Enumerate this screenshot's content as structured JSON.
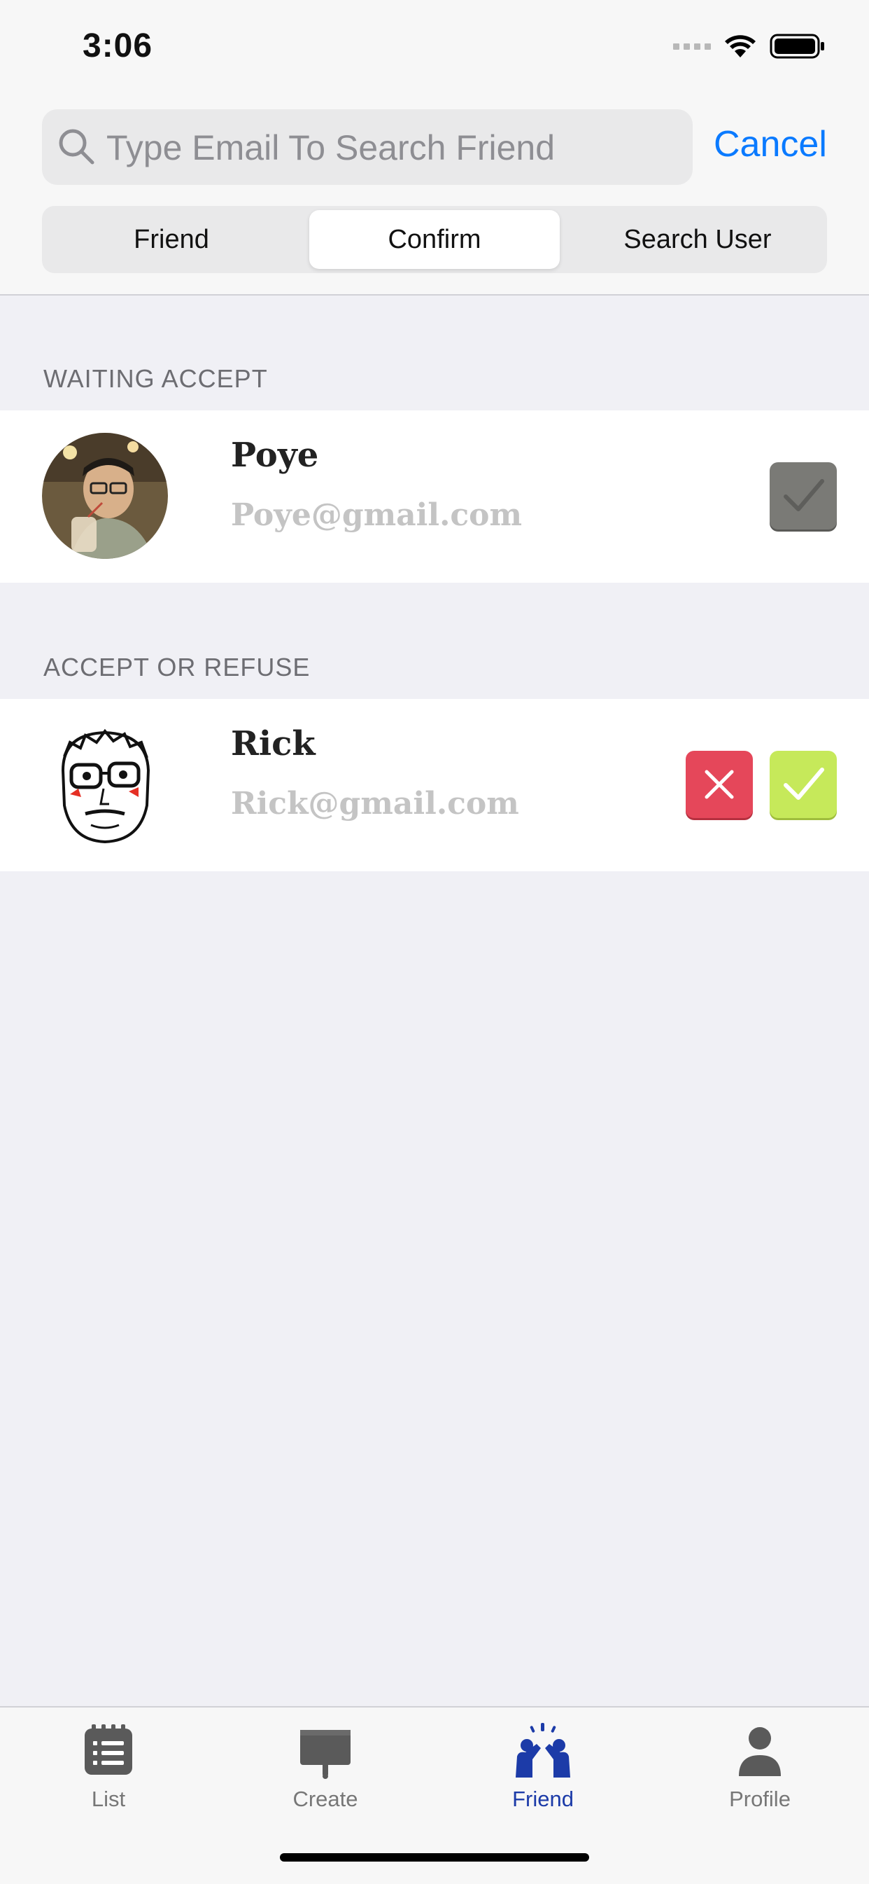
{
  "status_bar": {
    "time": "3:06"
  },
  "search": {
    "placeholder": "Type Email To Search Friend",
    "cancel_label": "Cancel"
  },
  "segments": [
    {
      "label": "Friend",
      "selected": false
    },
    {
      "label": "Confirm",
      "selected": true
    },
    {
      "label": "Search User",
      "selected": false
    }
  ],
  "sections": {
    "waiting": {
      "title": "WAITING ACCEPT",
      "item": {
        "name": "Poye",
        "email": "Poye@gmail.com",
        "status_icon": "check-icon-disabled"
      }
    },
    "accept_refuse": {
      "title": "ACCEPT OR REFUSE",
      "item": {
        "name": "Rick",
        "email": "Rick@gmail.com",
        "refuse_icon": "x-icon",
        "accept_icon": "check-icon"
      }
    }
  },
  "tabbar": {
    "items": [
      {
        "label": "List",
        "icon": "list-icon"
      },
      {
        "label": "Create",
        "icon": "board-icon"
      },
      {
        "label": "Friend",
        "icon": "friends-icon",
        "active": true
      },
      {
        "label": "Profile",
        "icon": "person-icon"
      }
    ]
  },
  "colors": {
    "accent_blue": "#0a7aff",
    "tab_active": "#1c3ba8",
    "refuse_red": "#e5475a",
    "accept_green": "#c6e95a",
    "disabled_gray": "#7a7a76"
  }
}
